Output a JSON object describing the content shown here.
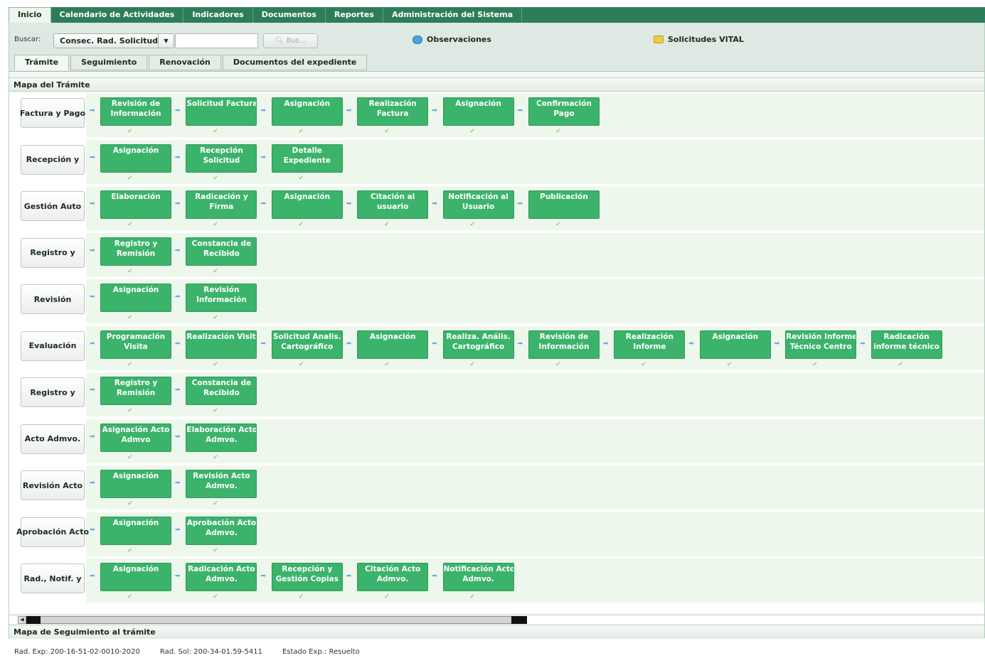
{
  "topnav": {
    "tabs": [
      "Inicio",
      "Calendario de Actividades",
      "Indicadores",
      "Documentos",
      "Reportes",
      "Administración del Sistema"
    ]
  },
  "search": {
    "label": "Buscar:",
    "field_selected": "Consec. Rad. Solicitud",
    "input_value": "",
    "button_label": "Bus...",
    "observaciones": "Observaciones",
    "vital": "Solicitudes VITAL"
  },
  "subtabs": [
    "Trámite",
    "Seguimiento",
    "Renovación",
    "Documentos del expediente"
  ],
  "map": {
    "title": "Mapa del Trámite",
    "stages": [
      {
        "label": "Factura y Pago",
        "tasks": [
          "Revisión de\nInformación",
          "Solicitud Factura",
          "Asignación",
          "Realización\nFactura",
          "Asignación",
          "Confirmación\nPago"
        ]
      },
      {
        "label": "Recepción y",
        "tasks": [
          "Asignación",
          "Recepción\nSolicitud",
          "Detalle\nExpediente"
        ]
      },
      {
        "label": "Gestión Auto",
        "tasks": [
          "Elaboración",
          "Radicación y\nFirma",
          "Asignación",
          "Citación al\nusuario",
          "Notificación al\nUsuario",
          "Publicación"
        ]
      },
      {
        "label": "Registro y",
        "tasks": [
          "Registro y\nRemisión",
          "Constancia de\nRecibido"
        ]
      },
      {
        "label": "Revisión",
        "tasks": [
          "Asignación",
          "Revisión\nInformación"
        ]
      },
      {
        "label": "Evaluación",
        "tasks": [
          "Programación\nVisita",
          "Realización Visita",
          "Solicitud Analis.\nCartográfico",
          "Asignación",
          "Realiza. Anális.\nCartográfico",
          "Revisión de\nInformación",
          "Realización\nInforme",
          "Asignación",
          "Revisión Informe\nTécnico Centro",
          "Radicación\ninforme técnico"
        ]
      },
      {
        "label": "Registro y",
        "tasks": [
          "Registro y\nRemisión",
          "Constancia de\nRecibido"
        ]
      },
      {
        "label": "Acto Admvo.",
        "tasks": [
          "Asignación Acto\nAdmvo",
          "Elaboración Acto\nAdmvo."
        ]
      },
      {
        "label": "Revisión Acto",
        "tasks": [
          "Asignación",
          "Revisión Acto\nAdmvo."
        ]
      },
      {
        "label": "Aprobación Acto",
        "tasks": [
          "Asignación",
          "Aprobación Acto\nAdmvo."
        ]
      },
      {
        "label": "Rad., Notif. y",
        "tasks": [
          "Asignación",
          "Radicación Acto\nAdmvo.",
          "Recepción y\nGestión Copias",
          "Citación Acto\nAdmvo.",
          "Notificación Acto\nAdmvo."
        ]
      }
    ]
  },
  "seguimiento_title": "Mapa de Seguimiento al trámite",
  "status": {
    "rad_exp": "Rad. Exp:   200-16-51-02-0010-2020",
    "rad_sol": "Rad. Sol:   200-34-01.59-5411",
    "estado": "Estado Exp.: Resuelto"
  },
  "colors": {
    "nav": "#2e7d5a",
    "task": "#3cb36b",
    "band": "#eef7ec"
  },
  "icons": {
    "arrow": "arrow-right-icon",
    "check": "check-icon",
    "bubble": "speech-bubble-icon",
    "folder": "folder-icon"
  }
}
